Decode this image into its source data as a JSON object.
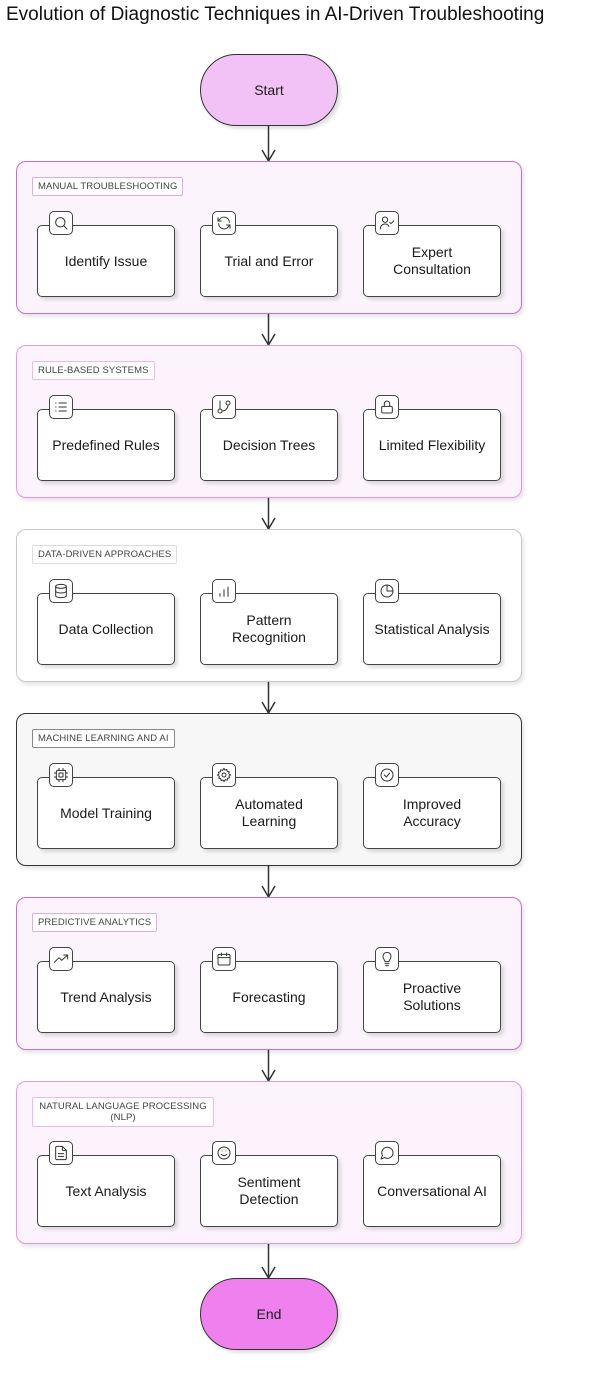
{
  "title": "Evolution of Diagnostic Techniques in AI-Driven Troubleshooting",
  "start": {
    "label": "Start",
    "color": "#f2c1f5"
  },
  "end": {
    "label": "End",
    "color": "#ef80ee"
  },
  "groups": [
    {
      "label": "MANUAL TROUBLESHOOTING",
      "nodes": [
        {
          "label": "Identify Issue",
          "icon": "search-icon"
        },
        {
          "label": "Trial and Error",
          "icon": "refresh-icon"
        },
        {
          "label": "Expert Consultation",
          "icon": "user-check-icon"
        }
      ]
    },
    {
      "label": "RULE-BASED SYSTEMS",
      "nodes": [
        {
          "label": "Predefined Rules",
          "icon": "list-icon"
        },
        {
          "label": "Decision Trees",
          "icon": "git-branch-icon"
        },
        {
          "label": "Limited Flexibility",
          "icon": "lock-icon"
        }
      ]
    },
    {
      "label": "DATA-DRIVEN APPROACHES",
      "nodes": [
        {
          "label": "Data Collection",
          "icon": "database-icon"
        },
        {
          "label": "Pattern Recognition",
          "icon": "bar-chart-icon"
        },
        {
          "label": "Statistical Analysis",
          "icon": "pie-chart-icon"
        }
      ]
    },
    {
      "label": "MACHINE LEARNING AND AI",
      "nodes": [
        {
          "label": "Model Training",
          "icon": "cpu-icon"
        },
        {
          "label": "Automated Learning",
          "icon": "gear-icon"
        },
        {
          "label": "Improved Accuracy",
          "icon": "check-circle-icon"
        }
      ]
    },
    {
      "label": "PREDICTIVE ANALYTICS",
      "nodes": [
        {
          "label": "Trend Analysis",
          "icon": "trending-up-icon"
        },
        {
          "label": "Forecasting",
          "icon": "calendar-icon"
        },
        {
          "label": "Proactive Solutions",
          "icon": "lightbulb-icon"
        }
      ]
    },
    {
      "label": "NATURAL LANGUAGE PROCESSING (NLP)",
      "nodes": [
        {
          "label": "Text Analysis",
          "icon": "file-text-icon"
        },
        {
          "label": "Sentiment Detection",
          "icon": "smile-icon"
        },
        {
          "label": "Conversational AI",
          "icon": "message-circle-icon"
        }
      ]
    }
  ]
}
